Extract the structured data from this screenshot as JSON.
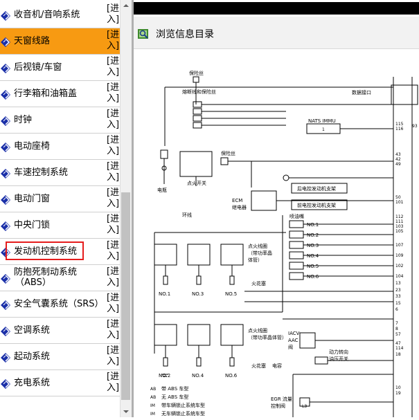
{
  "sidebar": {
    "enter_label": "[进入]",
    "items": [
      {
        "label": "收音机/音响系统"
      },
      {
        "label": "天窗线路",
        "selected": true
      },
      {
        "label": "后视镜/车窗"
      },
      {
        "label": "行李箱和油箱盖"
      },
      {
        "label": "时钟"
      },
      {
        "label": "电动座椅"
      },
      {
        "label": "车速控制系统"
      },
      {
        "label": "电动门窗"
      },
      {
        "label": "中央门锁"
      },
      {
        "label": "发动机控制系统",
        "highlighted": true
      },
      {
        "label": "防抱死制动系统",
        "label2": "（ABS）"
      },
      {
        "label": "安全气囊系统（SRS）"
      },
      {
        "label": "空调系统"
      },
      {
        "label": "起动系统"
      },
      {
        "label": "充电系统"
      }
    ]
  },
  "colors": {
    "selected_bg": "#f79a12",
    "highlight_border": "#e51c1c",
    "icon_blue": "#1a2fa8"
  },
  "viewer": {
    "title": "浏览信息目录",
    "diagram": {
      "fuse": "保险丝",
      "fuse_link": "熔断线和保险丝",
      "data_port": "数据接口",
      "nats": "NATS IMMU",
      "battery": "电瓶",
      "ignition_switch": "点火开关",
      "ecm_relay_1": "ECM",
      "ecm_relay_2": "继电器",
      "rear_harness": "后电控发动机支架",
      "front_harness": "前电控发动机支架",
      "ring": "环线",
      "injectors": "喷油嘴",
      "coil_a_1": "点火线圈",
      "coil_a_2": "（带功率晶",
      "coil_a_3": "体管）",
      "coil_b": "点火线圈",
      "coil_b_2": "（带功率晶体管）",
      "spark_plug": "火花塞",
      "capacitor": "电容",
      "iacv_1": "IACV",
      "iacv_2": "AAC",
      "iacv_3": "阀",
      "power_steer_1": "动力转向",
      "power_steer_2": "油压开关",
      "egr_1": "EGR 流量",
      "egr_2": "控制阀",
      "legend_1": "带 ABS 车型",
      "legend_2": "无 ABS 车型",
      "legend_3": "带车辆锁止系统车型",
      "legend_4": "无车辆锁止系统车型",
      "legend_tags": [
        "AB",
        "AB",
        "IM",
        "IM"
      ],
      "coil_labels": [
        "NO.1",
        "NO.3",
        "NO.5",
        "NO.2",
        "NO.4",
        "NO.6"
      ],
      "injector_labels": [
        "NO.1",
        "NO.2",
        "NO.3",
        "NO.4",
        "NO.5",
        "NO.6"
      ],
      "pins": [
        "115",
        "116",
        "43",
        "42",
        "49",
        "50",
        "101",
        "112",
        "111",
        "103",
        "105",
        "107",
        "109",
        "102",
        "104",
        "13",
        "23",
        "33",
        "15",
        "6",
        "7",
        "8",
        "57",
        "47",
        "114",
        "18",
        "10",
        "19"
      ],
      "pin_top_right": "93",
      "pin_box_label": "1",
      "tag_l3": "L3"
    }
  }
}
